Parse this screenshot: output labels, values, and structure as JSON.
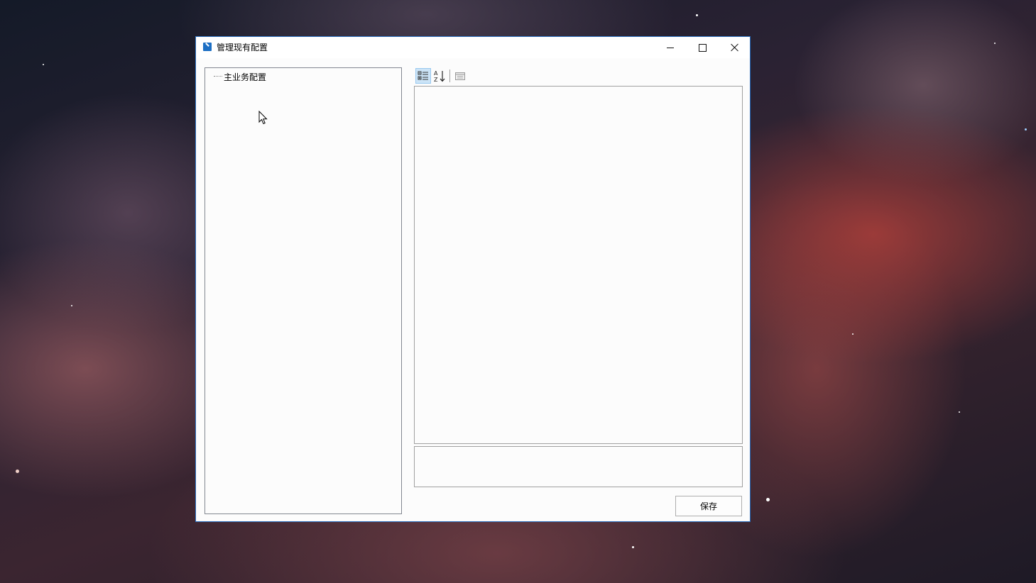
{
  "window": {
    "title": "管理现有配置",
    "icon": "wrench-app-icon",
    "accent_color": "#2a6fbf"
  },
  "caption_buttons": {
    "minimize_icon": "minimize-icon",
    "maximize_icon": "maximize-icon",
    "close_icon": "close-icon"
  },
  "tree": {
    "nodes": [
      {
        "label": "主业务配置"
      }
    ]
  },
  "property_toolbar": {
    "categorized_icon": "categorized-view-icon",
    "alphabetical_icon": "sort-az-icon",
    "pages_icon": "property-pages-icon",
    "categorized_selected": true
  },
  "actions": {
    "save_label": "保存"
  }
}
